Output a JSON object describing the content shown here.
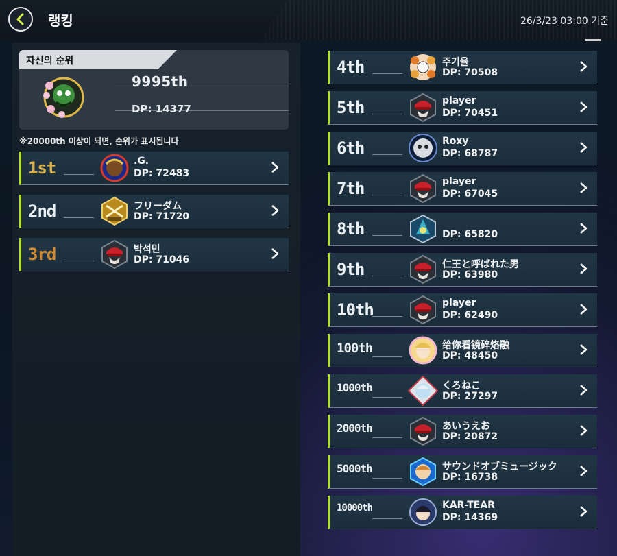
{
  "header": {
    "title": "랭킹",
    "date": "26/3/23 03:00 기준"
  },
  "my_rank": {
    "header_label": "자신의 순위",
    "rank": "9995th",
    "dp": "DP: 14377",
    "note": "※20000th 이상이 되면, 순위가 표시됩니다"
  },
  "left_rankings": [
    {
      "rank": "1st",
      "name": ".G.",
      "dp": "DP: 72483",
      "avatar": "dark-skin-avatar-icon"
    },
    {
      "rank": "2nd",
      "name": "フリーダム",
      "dp": "DP: 71720",
      "avatar": "gold-badge-2025-icon"
    },
    {
      "rank": "3rd",
      "name": "박석민",
      "dp": "DP: 71046",
      "avatar": "red-cap-duelist-icon"
    }
  ],
  "right_rankings": [
    {
      "rank": "4th",
      "name": "주기율",
      "dp": "DP: 70508",
      "avatar": "flower-mask-icon"
    },
    {
      "rank": "5th",
      "name": "player",
      "dp": "DP: 70451",
      "avatar": "red-cap-duelist-icon"
    },
    {
      "rank": "6th",
      "name": "Roxy",
      "dp": "DP: 68787",
      "avatar": "vortex-face-icon"
    },
    {
      "rank": "7th",
      "name": "player",
      "dp": "DP: 67045",
      "avatar": "red-cap-duelist-icon"
    },
    {
      "rank": "8th",
      "name": "",
      "dp": "DP: 65820",
      "avatar": "blue-dragon-crest-icon"
    },
    {
      "rank": "9th",
      "name": "仁王と呼ばれた男",
      "dp": "DP: 63980",
      "avatar": "red-cap-duelist-icon"
    },
    {
      "rank": "10th",
      "name": "player",
      "dp": "DP: 62490",
      "avatar": "red-cap-duelist-icon"
    },
    {
      "rank": "100th",
      "name": "给你看镜碎烙融",
      "dp": "DP: 48450",
      "avatar": "blonde-flower-frame-icon"
    },
    {
      "rank": "1000th",
      "name": "くろねこ",
      "dp": "DP: 27297",
      "avatar": "silver-frame-girl-icon"
    },
    {
      "rank": "2000th",
      "name": "あいうえお",
      "dp": "DP: 20872",
      "avatar": "red-cap-duelist-icon"
    },
    {
      "rank": "5000th",
      "name": "サウンドオブミュージック",
      "dp": "DP: 16738",
      "avatar": "blue-frame-girl-icon"
    },
    {
      "rank": "10000th",
      "name": "KAR-TEAR",
      "dp": "DP: 14369",
      "avatar": "dark-hair-girl-icon"
    }
  ],
  "colors": {
    "accent": "#b4e02a",
    "row_bg": "#213645",
    "gold": "#d9b04a",
    "bronze": "#d08a34"
  }
}
